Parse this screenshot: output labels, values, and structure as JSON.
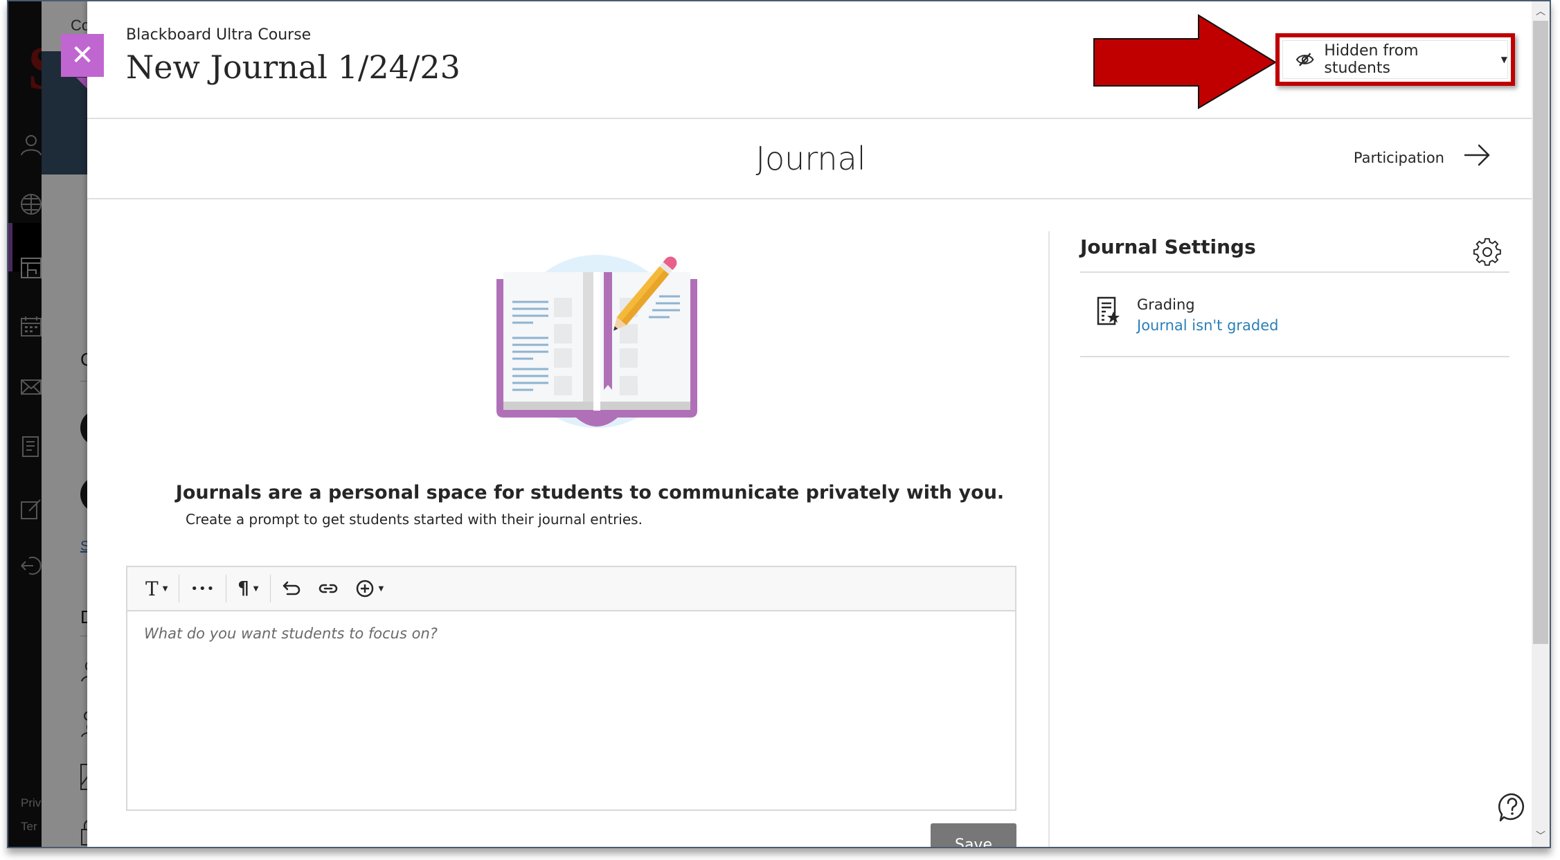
{
  "background": {
    "page_header_partial": "Co",
    "section_partial_1": "C",
    "section_partial_2": "D",
    "link_partial": "Sh",
    "footer_partial_1": "Priv",
    "footer_partial_2": "Ter",
    "nav_icons": [
      "profile-icon",
      "globe-icon",
      "courses-icon",
      "calendar-icon",
      "messages-icon",
      "grades-icon",
      "tools-icon",
      "sign-out-icon"
    ]
  },
  "header": {
    "close_label": "✕",
    "course_name": "Blackboard Ultra Course",
    "title": "New Journal 1/24/23",
    "visibility": {
      "label": "Hidden from students",
      "icon": "eye-slash-icon",
      "caret": "▼"
    }
  },
  "subheader": {
    "section_title": "Journal",
    "participation_label": "Participation"
  },
  "intro": {
    "heading": "Journals are a personal space for students to communicate privately with you.",
    "subtext": "Create a prompt to get students started with their journal entries."
  },
  "editor": {
    "toolbar": [
      {
        "name": "text-style",
        "glyph": "T",
        "has_caret": true
      },
      {
        "name": "more-formatting",
        "glyph": "•••",
        "has_caret": false
      },
      {
        "name": "paragraph",
        "glyph": "¶",
        "has_caret": true
      },
      {
        "name": "undo",
        "glyph": "⮌",
        "has_caret": false
      },
      {
        "name": "link",
        "glyph": "⛓",
        "has_caret": false
      },
      {
        "name": "insert-content",
        "glyph": "⊕",
        "has_caret": true
      }
    ],
    "placeholder": "What do you want students to focus on?",
    "save_label": "Save"
  },
  "settings": {
    "title": "Journal Settings",
    "grading_label": "Grading",
    "grading_value": "Journal isn't graded"
  },
  "annotation": {
    "arrow_color": "#c00000",
    "highlight_color": "#c00000"
  },
  "colors": {
    "close_button": "#c066d0",
    "link": "#2a7fb8",
    "save_button": "#777777"
  }
}
